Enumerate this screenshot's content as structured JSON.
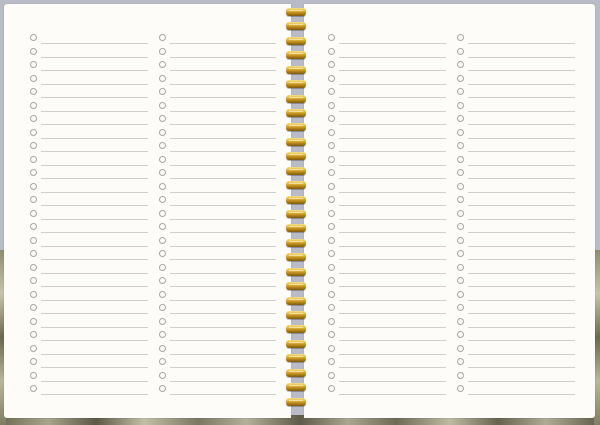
{
  "notebook": {
    "cover_color": "#b9bbc6",
    "page_color": "#fdfcf8",
    "spiral_color": "#d8a93a",
    "rows_per_column": 27,
    "ring_count": 28,
    "columns": [
      {
        "name": "left-page-column-1"
      },
      {
        "name": "left-page-column-2"
      },
      {
        "name": "right-page-column-1"
      },
      {
        "name": "right-page-column-2"
      }
    ]
  }
}
